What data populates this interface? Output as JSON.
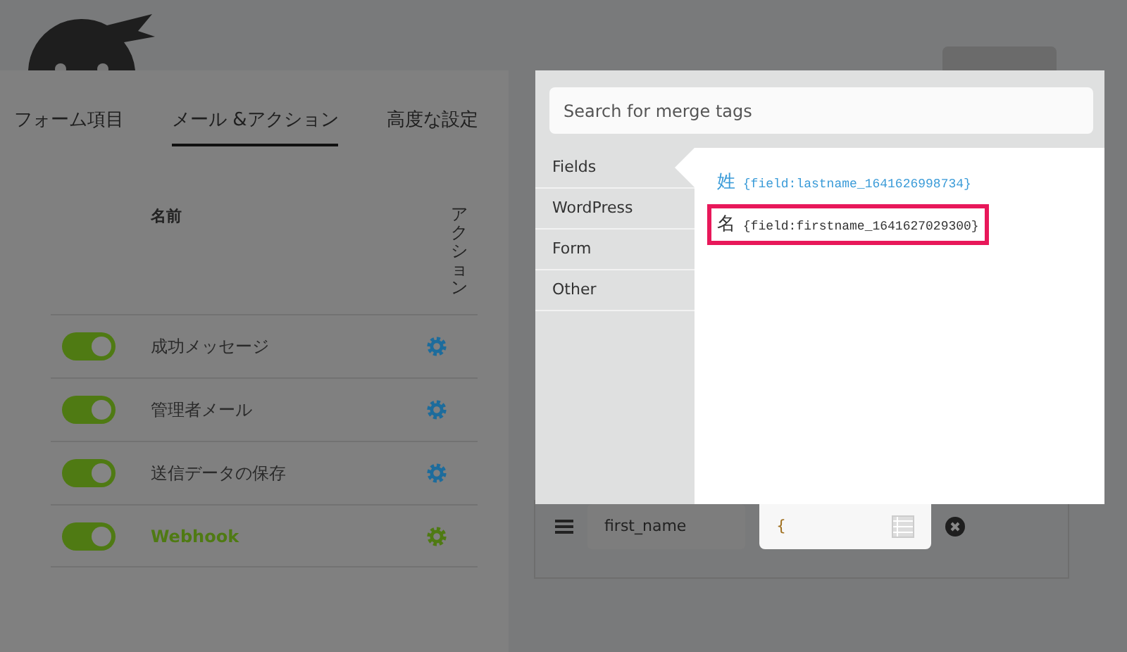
{
  "tabs": [
    {
      "label": "フォーム項目",
      "selected": false
    },
    {
      "label": "メール &アクション",
      "selected": true
    },
    {
      "label": "高度な設定",
      "selected": false
    }
  ],
  "table": {
    "columns": [
      "名前",
      "アクション"
    ],
    "rows": [
      {
        "name": "成功メッセージ",
        "enabled": true,
        "selected": false
      },
      {
        "name": "管理者メール",
        "enabled": true,
        "selected": false
      },
      {
        "name": "送信データの保存",
        "enabled": true,
        "selected": false
      },
      {
        "name": "Webhook",
        "enabled": true,
        "selected": true
      }
    ]
  },
  "field_row": {
    "key": "first_name",
    "value": "{"
  },
  "merge_popup": {
    "search": {
      "placeholder": "Search for merge tags"
    },
    "categories": [
      {
        "label": "Fields",
        "selected": true
      },
      {
        "label": "WordPress",
        "selected": false
      },
      {
        "label": "Form",
        "selected": false
      },
      {
        "label": "Other",
        "selected": false
      }
    ],
    "tags": [
      {
        "label": "姓",
        "tag": "{field:lastname_1641626998734}",
        "hovered": true,
        "highlighted": false
      },
      {
        "label": "名",
        "tag": "{field:firstname_1641627029300}",
        "hovered": false,
        "highlighted": true
      }
    ]
  }
}
